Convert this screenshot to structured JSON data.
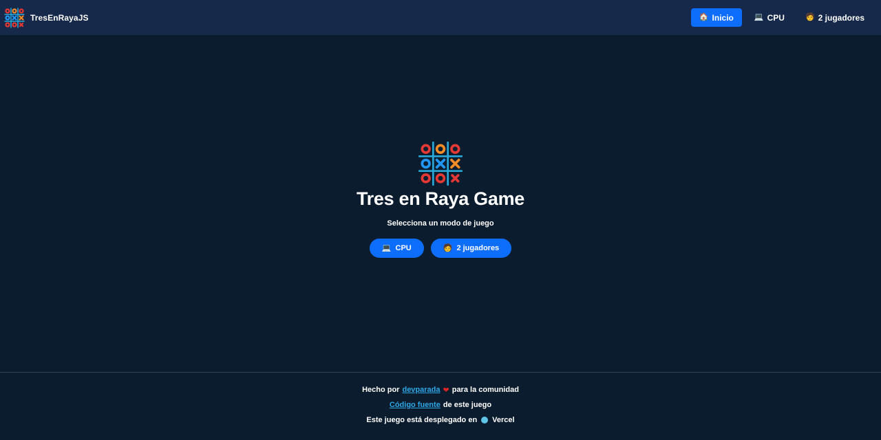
{
  "header": {
    "brand": "TresEnRayaJS",
    "nav": [
      {
        "icon": "🏠",
        "label": "Inicio",
        "active": true
      },
      {
        "icon": "💻",
        "label": "CPU",
        "active": false
      },
      {
        "icon": "🧑",
        "label": "2 jugadores",
        "active": false
      }
    ]
  },
  "hero": {
    "title": "Tres en Raya Game",
    "subtitle": "Selecciona un modo de juego",
    "buttons": [
      {
        "icon": "💻",
        "label": "CPU"
      },
      {
        "icon": "🧑",
        "label": "2 jugadores"
      }
    ]
  },
  "footer": {
    "line1_prefix": "Hecho por",
    "line1_link": "devparada",
    "line1_heart": "❤",
    "line1_suffix": "para la comunidad",
    "line2_link": "Código fuente",
    "line2_suffix": "de este juego",
    "line3_prefix": "Este juego está desplegado en",
    "line3_suffix": "Vercel"
  },
  "colors": {
    "background": "#0b1c2e",
    "navbar": "#17294a",
    "accent": "#0d6efd",
    "link": "#2fa8e8",
    "logo_grid": "#29a8d8",
    "logo_red": "#e53935",
    "logo_orange": "#f28c28",
    "logo_blue": "#2196f3"
  }
}
